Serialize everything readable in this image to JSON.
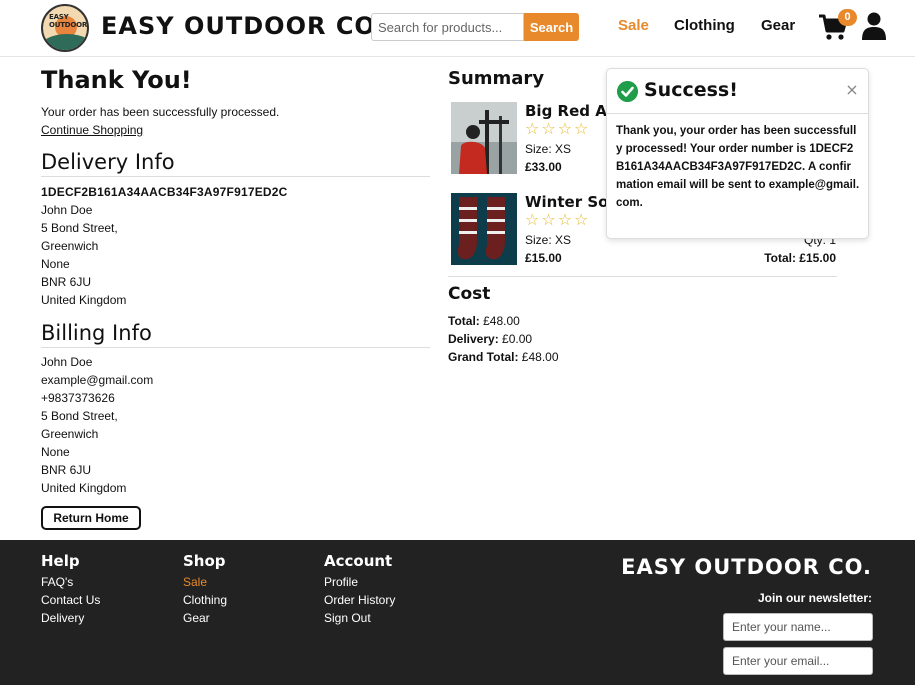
{
  "header": {
    "brand": "EASY OUTDOOR CO.",
    "logo_text": "EASY OUTDOOR",
    "search_placeholder": "Search for products...",
    "search_button": "Search",
    "nav": {
      "sale": "Sale",
      "clothing": "Clothing",
      "gear": "Gear"
    },
    "cart_count": "0",
    "accent_color": "#e8892b"
  },
  "confirmation": {
    "title": "Thank You!",
    "message": "Your order has been successfully processed.",
    "continue_link": "Continue Shopping"
  },
  "delivery": {
    "heading": "Delivery Info",
    "order_number": "1DECF2B161A34AACB34F3A97F917ED2C",
    "name": "John Doe",
    "address1": "5 Bond Street,",
    "address2": "Greenwich",
    "county": "None",
    "postcode": "BNR 6JU",
    "country": "United Kingdom"
  },
  "billing": {
    "heading": "Billing Info",
    "name": "John Doe",
    "email": "example@gmail.com",
    "phone": "+9837373626",
    "address1": "5 Bond Street,",
    "address2": "Greenwich",
    "county": "None",
    "postcode": "BNR 6JU",
    "country": "United Kingdom"
  },
  "return_button": "Return Home",
  "summary": {
    "heading": "Summary",
    "items": [
      {
        "name": "Big Red Ad",
        "stars": "☆☆☆☆",
        "size": "Size: XS",
        "price": "£33.00",
        "qty": "",
        "total": ""
      },
      {
        "name": "Winter Soc",
        "stars": "☆☆☆☆",
        "size": "Size: XS",
        "price": "£15.00",
        "qty": "Qty: 1",
        "total": "Total: £15.00"
      }
    ]
  },
  "cost": {
    "heading": "Cost",
    "total_label": "Total:",
    "total": "£48.00",
    "delivery_label": "Delivery:",
    "delivery": "£0.00",
    "grand_label": "Grand Total:",
    "grand": "£48.00"
  },
  "toast": {
    "title": "Success!",
    "close": "×",
    "message": "Thank you, your order has been successfully processed! Your order number is 1DECF2B161A34AACB34F3A97F917ED2C. A confirmation email will be sent to example@gmail.com.",
    "success_color": "#1f9d4a"
  },
  "footer": {
    "help": {
      "heading": "Help",
      "links": [
        "FAQ's",
        "Contact Us",
        "Delivery"
      ]
    },
    "shop": {
      "heading": "Shop",
      "links": [
        "Sale",
        "Clothing",
        "Gear"
      ]
    },
    "account": {
      "heading": "Account",
      "links": [
        "Profile",
        "Order History",
        "Sign Out"
      ]
    },
    "brand": "EASY OUTDOOR CO.",
    "newsletter_label": "Join our newsletter:",
    "name_placeholder": "Enter your name...",
    "email_placeholder": "Enter your email..."
  }
}
